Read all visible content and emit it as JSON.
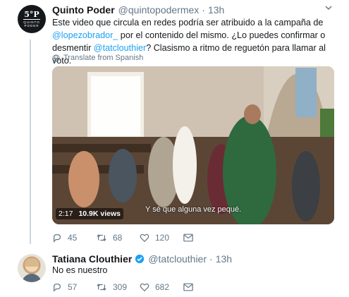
{
  "tweets": [
    {
      "display_name": "Quinto Poder",
      "handle": "@quintopodermex",
      "separator": "·",
      "time": "13h",
      "avatar_text_top": "5°P",
      "avatar_text_bottom": "QUINTO PODER",
      "text_parts": [
        "Este video que circula en redes podría ser atribuido a la campaña de ",
        "@lopezobrador_",
        " por el contenido del mismo. ¿Lo puedes confirmar o desmentir ",
        "@tatclouthier",
        "? Clasismo a ritmo de reguetón para llamar al voto."
      ],
      "translate_label": "Translate from Spanish",
      "video": {
        "subtitle": "Y sé que alguna vez pequé.",
        "duration": "2:17",
        "views": "10.9K views"
      },
      "actions": {
        "replies": "45",
        "retweets": "68",
        "likes": "120"
      }
    },
    {
      "display_name": "Tatiana Clouthier",
      "handle": "@tatclouthier",
      "separator": "·",
      "time": "13h",
      "text": "No es nuestro",
      "actions": {
        "replies": "57",
        "retweets": "309",
        "likes": "682"
      }
    }
  ],
  "colors": {
    "link": "#1da1f2",
    "secondary": "#657786",
    "thread_line": "#ccd6dd"
  },
  "icons": [
    "chevron-down-icon",
    "verified-badge-icon",
    "globe-icon",
    "reply-icon",
    "retweet-icon",
    "like-icon",
    "mail-icon"
  ]
}
